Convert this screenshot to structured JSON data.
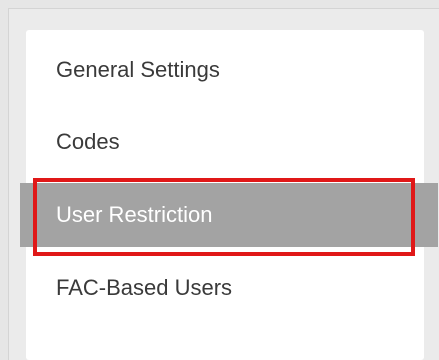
{
  "menu": {
    "items": [
      {
        "label": "General Settings",
        "selected": false
      },
      {
        "label": "Codes",
        "selected": false
      },
      {
        "label": "User Restriction",
        "selected": true
      },
      {
        "label": "FAC-Based Users",
        "selected": false
      }
    ]
  },
  "colors": {
    "selected_background": "#a3a3a3",
    "highlight_border": "#e01818",
    "panel_background": "#ffffff",
    "page_background": "#e6e6e6"
  }
}
